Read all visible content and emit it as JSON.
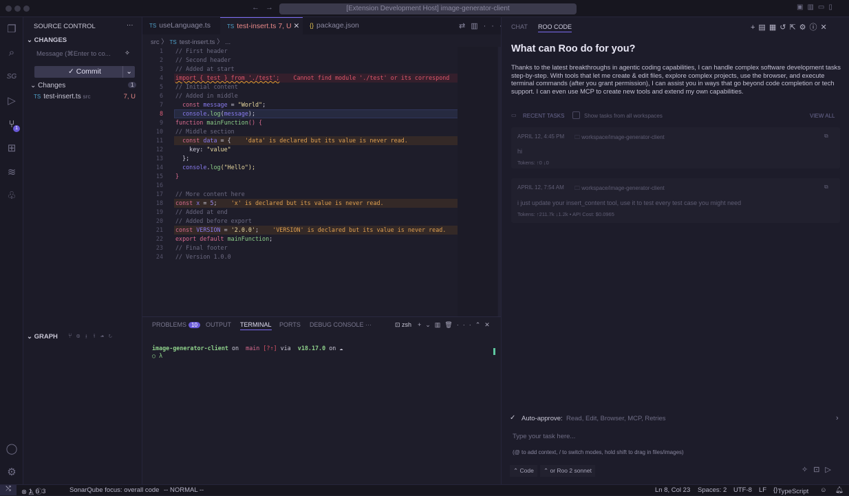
{
  "titlebar": {
    "search": "[Extension Development Host] image-generator-client"
  },
  "activity": {
    "items": [
      "files-icon",
      "search-icon",
      "sg-icon",
      "run-debug-icon",
      "source-control-icon",
      "extensions-icon",
      "roo-icon",
      "tree-icon"
    ],
    "sc_badge": "1",
    "bottom": [
      "account-icon",
      "settings-icon"
    ]
  },
  "sidebar": {
    "title": "SOURCE CONTROL",
    "section": "CHANGES",
    "message_placeholder": "Message (⌘Enter to co...",
    "commit": "✓ Commit",
    "changes_label": "Changes",
    "changes_count": "1",
    "file": {
      "name": "test-insert.ts",
      "dir": "src",
      "status": "7, U"
    },
    "graph": "GRAPH"
  },
  "editor": {
    "tabs": [
      {
        "icon": "TS",
        "label": "useLanguage.ts"
      },
      {
        "icon": "TS",
        "label": "test-insert.ts",
        "badge": "7, U"
      },
      {
        "icon": "{}",
        "label": "package.json"
      }
    ],
    "breadcrumb": {
      "folder": "src",
      "file": "test-insert.ts",
      "rest": "..."
    },
    "lines": [
      {
        "n": "1",
        "t": [
          [
            "// First header",
            "comment"
          ]
        ]
      },
      {
        "n": "2",
        "t": [
          [
            "// Second header",
            "comment"
          ]
        ]
      },
      {
        "n": "3",
        "t": [
          [
            "// Added at start",
            "comment"
          ]
        ]
      },
      {
        "n": "4",
        "bg": "err",
        "t": [
          [
            "import { test } from './test';",
            "import"
          ],
          [
            "    Cannot find module './test' or its correspond",
            "errtxt"
          ]
        ]
      },
      {
        "n": "5",
        "t": [
          [
            "// Initial content",
            "comment"
          ]
        ]
      },
      {
        "n": "6",
        "t": [
          [
            "// Added in middle",
            "comment"
          ]
        ]
      },
      {
        "n": "7",
        "t": [
          [
            "  const ",
            "kw"
          ],
          [
            "message",
            "var"
          ],
          [
            " = ",
            "plain"
          ],
          [
            "\"World\"",
            "str"
          ],
          [
            ";",
            "plain"
          ]
        ]
      },
      {
        "n": "8",
        "bg": "cur",
        "t": [
          [
            "  console",
            "var"
          ],
          [
            ".",
            "plain"
          ],
          [
            "log",
            "fn"
          ],
          [
            "(",
            "plain"
          ],
          [
            "message",
            "var"
          ],
          [
            ");",
            "plain"
          ]
        ]
      },
      {
        "n": "9",
        "t": [
          [
            "function ",
            "kw"
          ],
          [
            "mainFunction",
            "fn"
          ],
          [
            "() {",
            "kw"
          ]
        ]
      },
      {
        "n": "10",
        "t": [
          [
            "// Middle section",
            "comment"
          ]
        ]
      },
      {
        "n": "11",
        "bg": "warn",
        "t": [
          [
            "  const ",
            "kw"
          ],
          [
            "data",
            "var"
          ],
          [
            " = {",
            "plain"
          ],
          [
            "    'data' is declared but its value is never read.",
            "warntxt"
          ]
        ]
      },
      {
        "n": "12",
        "t": [
          [
            "    key",
            "plain"
          ],
          [
            ": ",
            "plain"
          ],
          [
            "\"value\"",
            "str"
          ]
        ]
      },
      {
        "n": "13",
        "t": [
          [
            "  };",
            "plain"
          ]
        ]
      },
      {
        "n": "14",
        "t": [
          [
            "  console",
            "var"
          ],
          [
            ".",
            "plain"
          ],
          [
            "log",
            "fn"
          ],
          [
            "(\"Hello\");",
            "str"
          ]
        ]
      },
      {
        "n": "15",
        "t": [
          [
            "}",
            "kw"
          ]
        ]
      },
      {
        "n": "16",
        "t": [
          [
            "",
            "plain"
          ]
        ]
      },
      {
        "n": "17",
        "t": [
          [
            "// More content here",
            "comment"
          ]
        ]
      },
      {
        "n": "18",
        "bg": "warn",
        "t": [
          [
            "const ",
            "kw"
          ],
          [
            "x",
            "var"
          ],
          [
            " = ",
            "plain"
          ],
          [
            "5",
            "num"
          ],
          [
            ";",
            "plain"
          ],
          [
            "    'x' is declared but its value is never read.",
            "warntxt"
          ]
        ]
      },
      {
        "n": "19",
        "t": [
          [
            "// Added at end",
            "comment"
          ]
        ]
      },
      {
        "n": "20",
        "t": [
          [
            "// Added before export",
            "comment"
          ]
        ]
      },
      {
        "n": "21",
        "bg": "warn",
        "t": [
          [
            "const ",
            "kw"
          ],
          [
            "VERSION",
            "var"
          ],
          [
            " = ",
            "plain"
          ],
          [
            "'2.0.0'",
            "str"
          ],
          [
            ";",
            "plain"
          ],
          [
            "    'VERSION' is declared but its value is never read.",
            "warntxt"
          ]
        ]
      },
      {
        "n": "22",
        "t": [
          [
            "export default ",
            "kw"
          ],
          [
            "mainFunction",
            "fn"
          ],
          [
            ";",
            "plain"
          ]
        ]
      },
      {
        "n": "23",
        "t": [
          [
            "// Final footer",
            "comment"
          ]
        ]
      },
      {
        "n": "24",
        "t": [
          [
            "// Version 1.0.0",
            "comment"
          ]
        ]
      }
    ],
    "current_line": "8"
  },
  "panel": {
    "tabs": [
      "PROBLEMS",
      "OUTPUT",
      "TERMINAL",
      "PORTS",
      "DEBUG CONSOLE"
    ],
    "problems_count": "10",
    "active": "TERMINAL",
    "shell": "zsh",
    "terminal": {
      "dir": "image-generator-client",
      "on": " on ",
      "branch": " main",
      "status": " [?⇡]",
      "via": " via ",
      "node": " v18.17.0",
      "on2": " on ☁",
      "prompt": "○ λ"
    }
  },
  "roo": {
    "tabs": [
      "CHAT",
      "ROO CODE"
    ],
    "title": "What can Roo do for you?",
    "intro": "Thanks to the latest breakthroughs in agentic coding capabilities, I can handle complex software development tasks step-by-step. With tools that let me create & edit files, explore complex projects, use the browser, and execute terminal commands (after you grant permission), I can assist you in ways that go beyond code completion or tech support. I can even use MCP to create new tools and extend my own capabilities.",
    "recent_label": "RECENT TASKS",
    "show_all": "Show tasks from all workspaces",
    "view_all": "VIEW ALL",
    "tasks": [
      {
        "date": "APRIL 12, 4:45 PM",
        "workspace": "workspace/image-generator-client",
        "text": "hi",
        "meta": "Tokens: ↑0 ↓0"
      },
      {
        "date": "APRIL 12, 7:54 AM",
        "workspace": "workspace/image-generator-client",
        "text": "i just update your insert_content tool, use it to test every test case you might need",
        "meta": "Tokens: ↑211.7k ↓1.2k • API Cost: $0.0965"
      }
    ],
    "auto_label": "Auto-approve:",
    "auto_value": "Read, Edit, Browser, MCP, Retries",
    "input_placeholder": "Type your task here...",
    "hint": "(@ to add context, / to switch modes, hold shift to drag in files/images)",
    "mode": "Code",
    "model": "or Roo 2 sonnet"
  },
  "status": {
    "errors": "1",
    "warnings": "6",
    "info": "3",
    "sonar": "SonarQube focus: overall code",
    "vim": "-- NORMAL --",
    "pos": "Ln 8, Col 23",
    "spaces": "Spaces: 2",
    "enc": "UTF-8",
    "eol": "LF",
    "lang": "TypeScript"
  },
  "colors": {
    "accent": "#7d6cf0",
    "error": "#e0566a",
    "warning": "#e0a050"
  }
}
